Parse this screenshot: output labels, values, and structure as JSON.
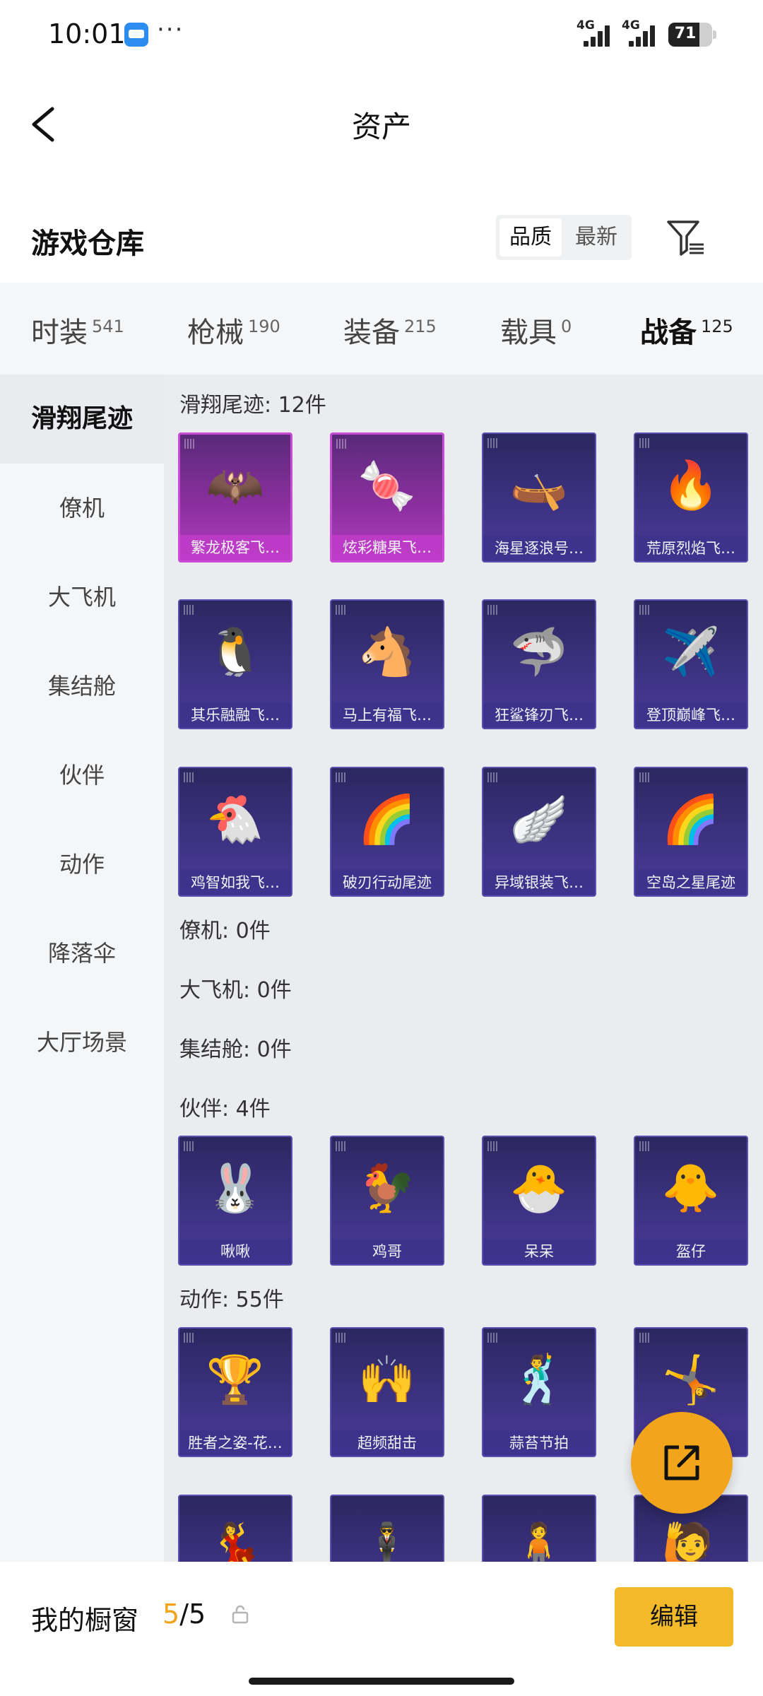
{
  "status_bar": {
    "time": "10:01",
    "dots": "···",
    "net1": "4G",
    "net2": "4G",
    "battery": "71"
  },
  "nav": {
    "title": "资产"
  },
  "warehouse": {
    "title": "游戏仓库",
    "sort_options": [
      "品质",
      "最新"
    ],
    "active_sort": "品质"
  },
  "tabs": [
    {
      "label": "时装",
      "count": "541"
    },
    {
      "label": "枪械",
      "count": "190"
    },
    {
      "label": "装备",
      "count": "215"
    },
    {
      "label": "载具",
      "count": "0"
    },
    {
      "label": "战备",
      "count": "125"
    }
  ],
  "side_menu": [
    "滑翔尾迹",
    "僚机",
    "大飞机",
    "集结舱",
    "伙伴",
    "动作",
    "降落伞",
    "大厅场景"
  ],
  "sections": {
    "glide": {
      "title": "滑翔尾迹: 12件"
    },
    "wingman": {
      "title": "僚机: 0件"
    },
    "plane": {
      "title": "大飞机: 0件"
    },
    "pod": {
      "title": "集结舱: 0件"
    },
    "partner": {
      "title": "伙伴: 4件"
    },
    "emote": {
      "title": "动作: 55件"
    }
  },
  "glide_items": [
    "繁龙极客飞…",
    "炫彩糖果飞…",
    "海星逐浪号…",
    "荒原烈焰飞…",
    "其乐融融飞…",
    "马上有福飞…",
    "狂鲨锋刃飞…",
    "登顶巅峰飞…",
    "鸡智如我飞…",
    "破刃行动尾迹",
    "异域银装飞…",
    "空岛之星尾迹"
  ],
  "partner_items": [
    "啾啾",
    "鸡哥",
    "呆呆",
    "盔仔"
  ],
  "emote_items": [
    "胜者之姿-花…",
    "超频甜击",
    "蒜苔节拍",
    ""
  ],
  "bottom": {
    "label": "我的橱窗",
    "current": "5",
    "separator": "/",
    "total": "5",
    "edit": "编辑"
  },
  "colors": {
    "accent": "#f2a51a",
    "edit_button": "#f2b92a",
    "card_bg": "#3d3282",
    "card_highlight": "#b33ec0"
  }
}
